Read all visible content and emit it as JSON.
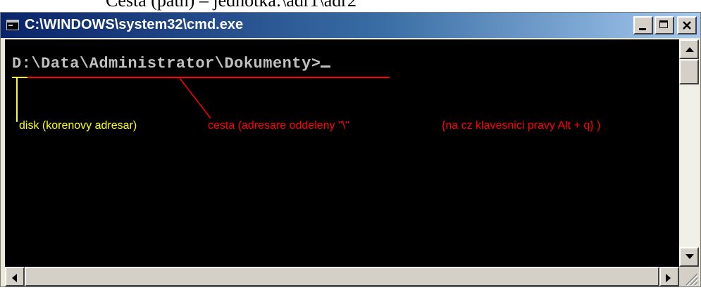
{
  "document": {
    "text": "Cesta (path) – jednotka:\\adr1\\adr2"
  },
  "window": {
    "title": "C:\\WINDOWS\\system32\\cmd.exe",
    "icon": "console-icon",
    "controls": {
      "minimize": "minimize-icon",
      "maximize": "maximize-icon",
      "close": "close-icon"
    }
  },
  "console": {
    "prompt": "D:\\Data\\Administrator\\Dokumenty>",
    "background": "#000000",
    "text_color": "#c0c0c0"
  },
  "annotations": {
    "disk_label": "disk (korenovy adresar)",
    "path_label": "cesta (adresare oddeleny  \"\\\"",
    "keyboard_label": "{na cz klavesnici pravy Alt + q} )",
    "disk_color": "#ffff00",
    "path_color": "#ff0000"
  },
  "scrollbars": {
    "vertical": {
      "up": "arrow-up-icon",
      "down": "arrow-down-icon"
    },
    "horizontal": {
      "left": "arrow-left-icon",
      "right": "arrow-right-icon"
    }
  }
}
